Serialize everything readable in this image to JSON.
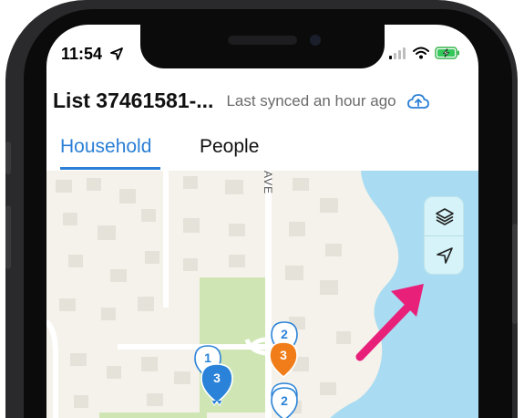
{
  "status_bar": {
    "time": "11:54"
  },
  "header": {
    "title": "List 37461581-...",
    "sync_status": "Last synced an hour ago"
  },
  "tabs": [
    {
      "label": "Household",
      "active": true
    },
    {
      "label": "People",
      "active": false
    }
  ],
  "map": {
    "street_label": "AVE",
    "controls": {
      "layers_icon": "layers-icon",
      "locate_icon": "navigation-arrow-icon"
    },
    "clusters": [
      {
        "count": "2",
        "style": "outline"
      },
      {
        "count": "1",
        "style": "outline"
      },
      {
        "count": "3",
        "style": "orange"
      },
      {
        "count": "3",
        "style": "blue"
      },
      {
        "count": "2",
        "style": "outline"
      }
    ]
  },
  "annotation": {
    "arrow_color": "#e8207a"
  },
  "colors": {
    "accent": "#2b7fd6",
    "water": "#a9dcf2",
    "park": "#cfe6b4",
    "orange_pin": "#f07d1a",
    "blue_pin": "#2a83d8"
  }
}
